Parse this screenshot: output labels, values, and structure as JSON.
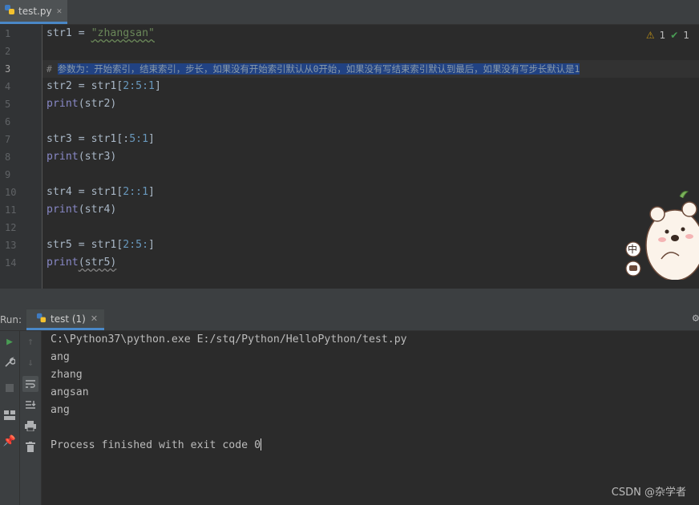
{
  "editor_tab": {
    "filename": "test.py"
  },
  "inspections": {
    "warnings": "1",
    "checks": "1"
  },
  "lines": [
    {
      "n": "1"
    },
    {
      "n": "2"
    },
    {
      "n": "3"
    },
    {
      "n": "4"
    },
    {
      "n": "5"
    },
    {
      "n": "6"
    },
    {
      "n": "7"
    },
    {
      "n": "8"
    },
    {
      "n": "9"
    },
    {
      "n": "10"
    },
    {
      "n": "11"
    },
    {
      "n": "12"
    },
    {
      "n": "13"
    },
    {
      "n": "14"
    }
  ],
  "code": {
    "l1_var": "str1 = ",
    "l1_str": "\"zhangsan\"",
    "l3_comment": "# 参数为：开始索引，结束索引，步长，如果没有开始索引默认从0开始，如果没有写结束索引默认到最后，如果没有写步长默认是1",
    "l4_a": "str2 = str1[",
    "l4_n": "2:5:1",
    "l4_b": "]",
    "l5_kw": "print",
    "l5_b": "(str2)",
    "l7_a": "str3 = str1[:",
    "l7_n": "5:1",
    "l7_b": "]",
    "l8_kw": "print",
    "l8_b": "(str3)",
    "l10_a": "str4 = str1[",
    "l10_n": "2::1",
    "l10_b": "]",
    "l11_kw": "print",
    "l11_b": "(str4)",
    "l13_a": "str5 = str1[",
    "l13_n": "2:5:",
    "l13_b": "]",
    "l14_kw": "print",
    "l14_b": "(str5)"
  },
  "run_panel": {
    "label": "Run:",
    "tab": "test (1)"
  },
  "console": {
    "command": "C:\\Python37\\python.exe E:/stq/Python/HelloPython/test.py",
    "out1": "ang",
    "out2": "zhang",
    "out3": "angsan",
    "out4": "ang",
    "exit": "Process finished with exit code 0"
  },
  "watermark": "CSDN @杂学者",
  "mascot_badges": {
    "top": "中"
  },
  "colors": {
    "accent": "#4a88c7",
    "keyword": "#8888c6",
    "string": "#6a8759",
    "number": "#6897bb",
    "comment": "#808080",
    "selection": "#214283"
  }
}
